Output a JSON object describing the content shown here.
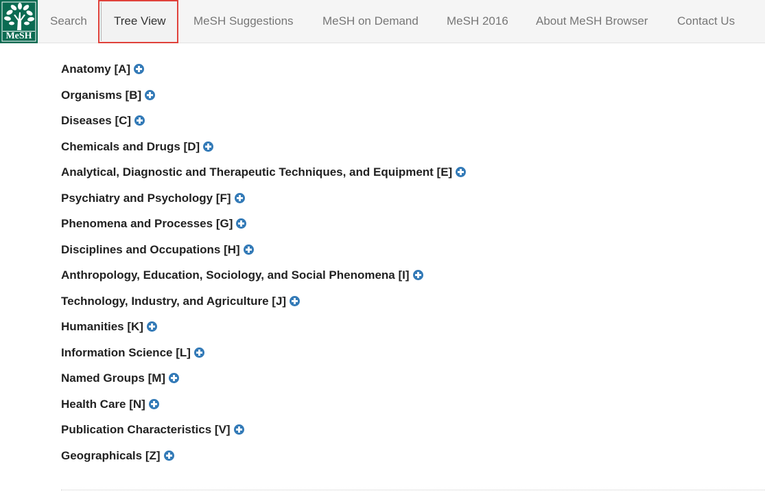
{
  "navbar": {
    "logo_text": "MeSH",
    "items": [
      {
        "label": "Search",
        "active": false
      },
      {
        "label": "Tree View",
        "active": true
      },
      {
        "label": "MeSH Suggestions",
        "active": false
      },
      {
        "label": "MeSH on Demand",
        "active": false
      },
      {
        "label": "MeSH 2016",
        "active": false
      },
      {
        "label": "About MeSH Browser",
        "active": false
      },
      {
        "label": "Contact Us",
        "active": false
      }
    ]
  },
  "tree": {
    "expand_icon": "plus-circle-icon",
    "accent_color": "#337ab7",
    "items": [
      {
        "label": "Anatomy [A]"
      },
      {
        "label": "Organisms [B]"
      },
      {
        "label": "Diseases [C]"
      },
      {
        "label": "Chemicals and Drugs [D]"
      },
      {
        "label": "Analytical, Diagnostic and Therapeutic Techniques, and Equipment [E]"
      },
      {
        "label": "Psychiatry and Psychology [F]"
      },
      {
        "label": "Phenomena and Processes [G]"
      },
      {
        "label": "Disciplines and Occupations [H]"
      },
      {
        "label": "Anthropology, Education, Sociology, and Social Phenomena [I]"
      },
      {
        "label": "Technology, Industry, and Agriculture [J]"
      },
      {
        "label": "Humanities [K]"
      },
      {
        "label": "Information Science [L]"
      },
      {
        "label": "Named Groups [M]"
      },
      {
        "label": "Health Care [N]"
      },
      {
        "label": "Publication Characteristics [V]"
      },
      {
        "label": "Geographicals [Z]"
      }
    ]
  }
}
